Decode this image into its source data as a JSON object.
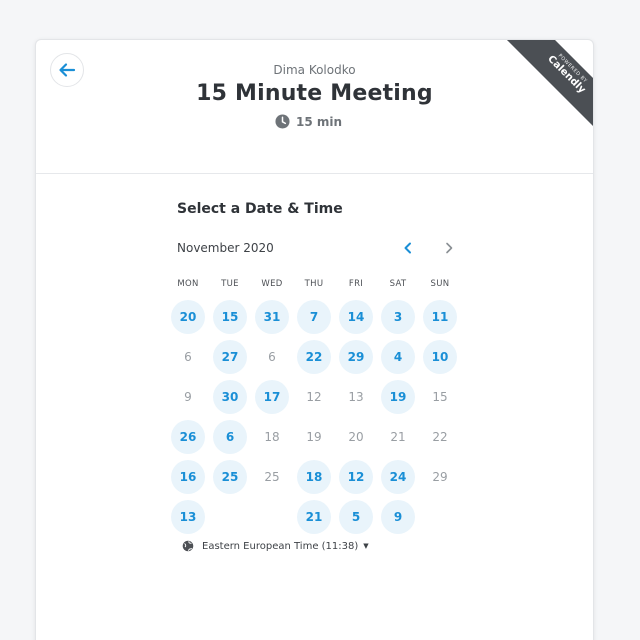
{
  "header": {
    "owner": "Dima Kolodko",
    "title": "15 Minute Meeting",
    "duration": "15 min"
  },
  "ribbon": {
    "small": "POWERED BY",
    "brand": "Calendly"
  },
  "section_title": "Select a Date & Time",
  "calendar": {
    "month": "November 2020",
    "weekdays": [
      "MON",
      "TUE",
      "WED",
      "THU",
      "FRI",
      "SAT",
      "SUN"
    ],
    "rows": [
      [
        {
          "t": "20",
          "a": true
        },
        {
          "t": "15",
          "a": true
        },
        {
          "t": "31",
          "a": true
        },
        {
          "t": "7",
          "a": true
        },
        {
          "t": "14",
          "a": true
        },
        {
          "t": "3",
          "a": true
        },
        {
          "t": "11",
          "a": true
        }
      ],
      [
        {
          "t": "6",
          "a": false
        },
        {
          "t": "27",
          "a": true
        },
        {
          "t": "6",
          "a": false
        },
        {
          "t": "22",
          "a": true
        },
        {
          "t": "29",
          "a": true
        },
        {
          "t": "4",
          "a": true
        },
        {
          "t": "10",
          "a": true
        }
      ],
      [
        {
          "t": "9",
          "a": false
        },
        {
          "t": "30",
          "a": true
        },
        {
          "t": "17",
          "a": true
        },
        {
          "t": "12",
          "a": false
        },
        {
          "t": "13",
          "a": false
        },
        {
          "t": "19",
          "a": true
        },
        {
          "t": "15",
          "a": false
        }
      ],
      [
        {
          "t": "26",
          "a": true
        },
        {
          "t": "6",
          "a": true
        },
        {
          "t": "18",
          "a": false
        },
        {
          "t": "19",
          "a": false
        },
        {
          "t": "20",
          "a": false
        },
        {
          "t": "21",
          "a": false
        },
        {
          "t": "22",
          "a": false
        }
      ],
      [
        {
          "t": "16",
          "a": true
        },
        {
          "t": "25",
          "a": true
        },
        {
          "t": "25",
          "a": false
        },
        {
          "t": "18",
          "a": true
        },
        {
          "t": "12",
          "a": true
        },
        {
          "t": "24",
          "a": true
        },
        {
          "t": "29",
          "a": false
        }
      ],
      [
        {
          "t": "13",
          "a": true
        },
        {
          "t": "",
          "a": false
        },
        {
          "t": "",
          "a": false
        },
        {
          "t": "21",
          "a": true
        },
        {
          "t": "5",
          "a": true
        },
        {
          "t": "9",
          "a": true
        },
        {
          "t": "",
          "a": false
        }
      ]
    ]
  },
  "timezone": "Eastern European Time (11:38)",
  "colors": {
    "accent": "#1a8fd6",
    "available_bg": "#e9f4fb",
    "ribbon": "#4b4f54",
    "title": "#2f3338"
  },
  "icons": {
    "back": "arrow-left-icon",
    "clock": "clock-icon",
    "prev": "chevron-left-icon",
    "next": "chevron-right-icon",
    "globe": "globe-icon"
  }
}
